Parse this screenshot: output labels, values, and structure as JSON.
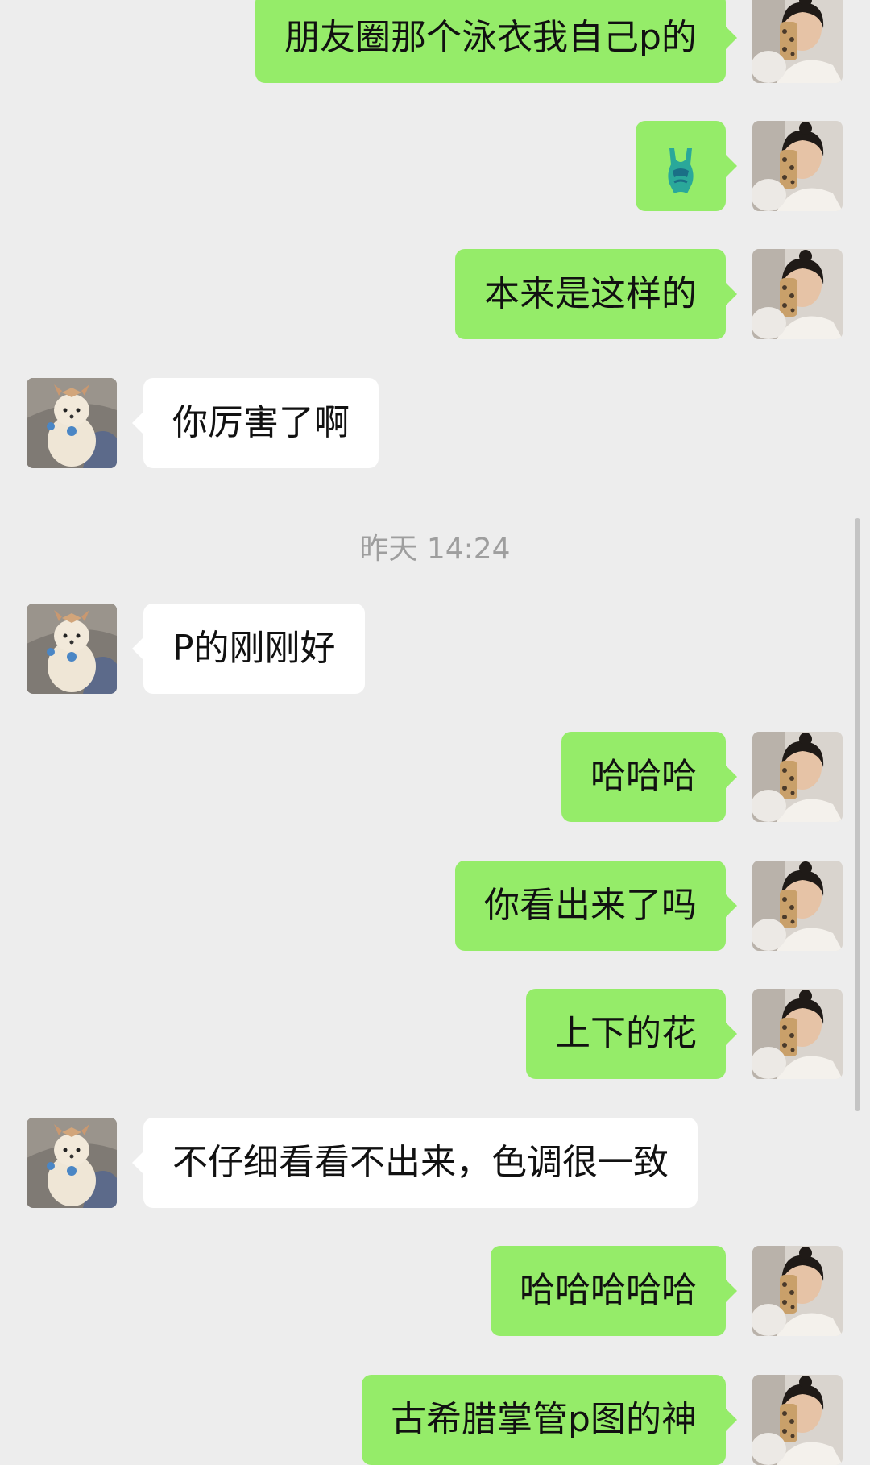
{
  "chat": {
    "timestamp": "昨天 14:24",
    "messages": [
      {
        "from": "me",
        "text": "朋友圈那个泳衣我自己p的"
      },
      {
        "from": "me",
        "icon": "swimsuit-emoji"
      },
      {
        "from": "me",
        "text": "本来是这样的"
      },
      {
        "from": "other",
        "text": "你厉害了啊"
      },
      {
        "from": "other",
        "text": "P的刚刚好"
      },
      {
        "from": "me",
        "text": "哈哈哈"
      },
      {
        "from": "me",
        "text": "你看出来了吗"
      },
      {
        "from": "me",
        "text": "上下的花"
      },
      {
        "from": "other",
        "text": "不仔细看看不出来，色调很一致"
      },
      {
        "from": "me",
        "text": "哈哈哈哈哈"
      },
      {
        "from": "me",
        "text": "古希腊掌管p图的神"
      }
    ]
  },
  "colors": {
    "background": "#ededed",
    "outgoing_bubble": "#95ec69",
    "incoming_bubble": "#ffffff",
    "timestamp_text": "#9e9e9e"
  }
}
